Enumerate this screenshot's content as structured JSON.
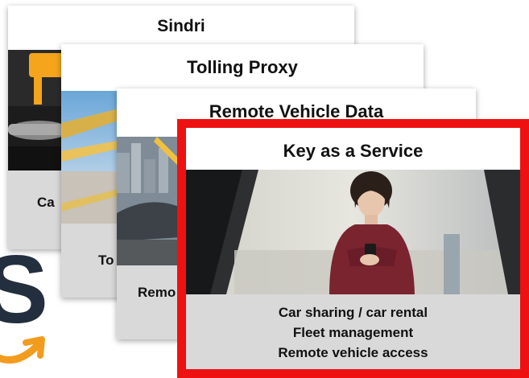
{
  "colors": {
    "highlight_border": "#ee1111",
    "caption_band": "#d9d9d9",
    "aws_orange": "#f29c1f",
    "aws_dark": "#232f3e"
  },
  "brand": {
    "logo_letter": "S",
    "logo_icon": "smile-arrow-icon"
  },
  "cards": {
    "sindri": {
      "title": "Sindri",
      "caption_partial": "Ca"
    },
    "tolling": {
      "title": "Tolling Proxy",
      "caption_partial": "To"
    },
    "remote_data": {
      "title": "Remote Vehicle Data",
      "caption_partial": "Remo"
    },
    "key_service": {
      "title": "Key as a Service",
      "captions": [
        "Car sharing / car rental",
        "Fleet management",
        "Remote vehicle access"
      ]
    }
  }
}
